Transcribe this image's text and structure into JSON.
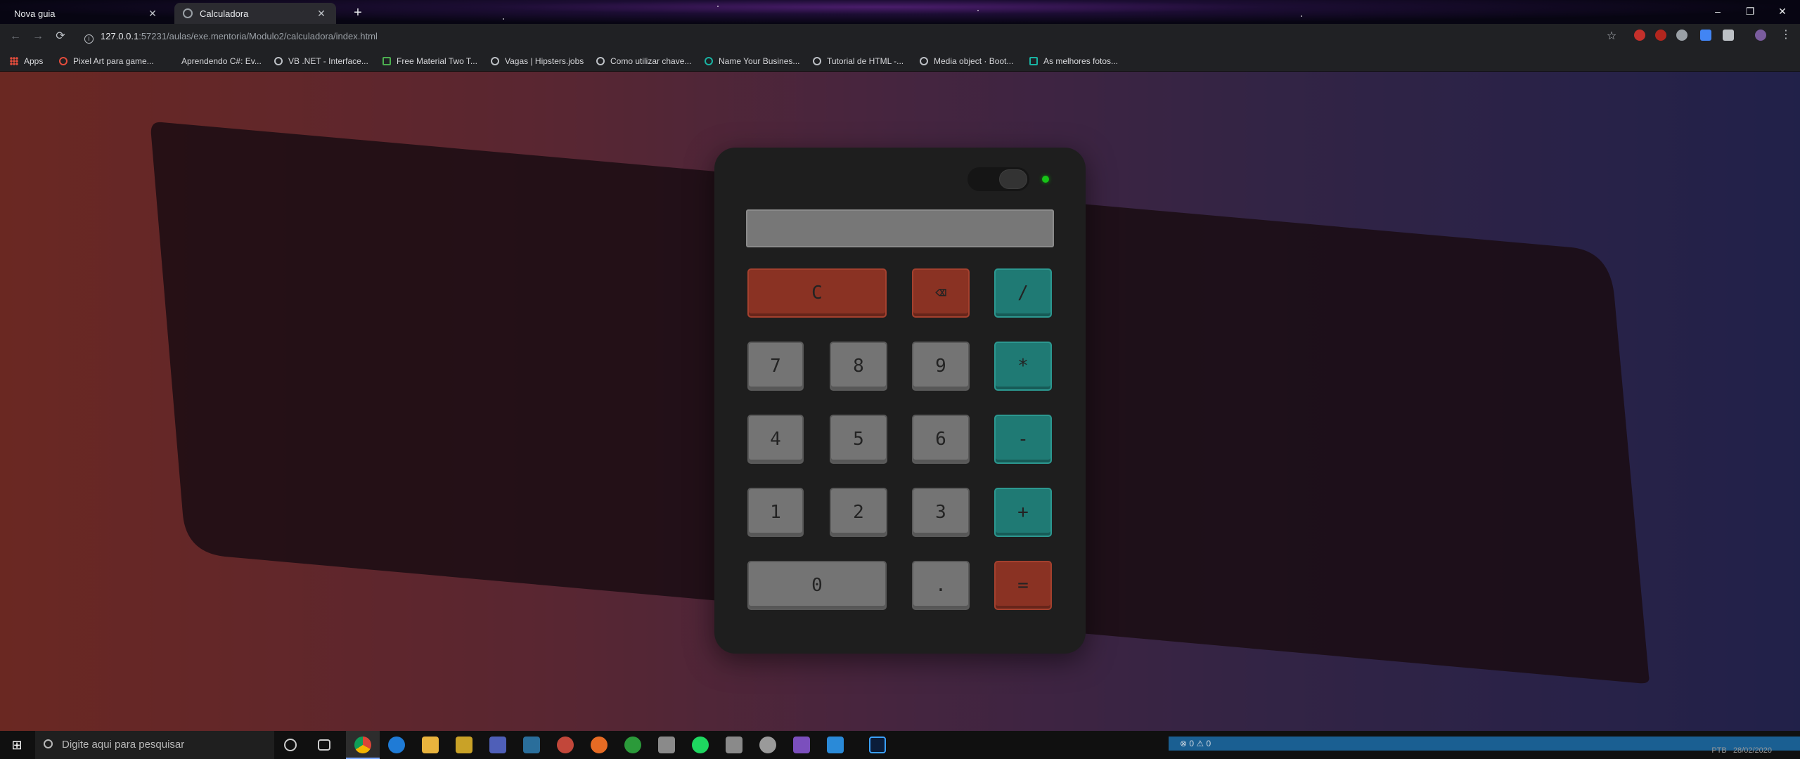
{
  "browser": {
    "tabs": [
      {
        "title": "Nova guia",
        "active": false
      },
      {
        "title": "Calculadora",
        "active": true
      }
    ],
    "new_tab_icon": "+",
    "window_controls": {
      "minimize": "–",
      "restore": "❐",
      "close": "✕"
    },
    "nav": {
      "back": "←",
      "forward": "→",
      "reload": "⟳"
    },
    "address": {
      "host": "127.0.0.1",
      "rest": ":57231/aulas/exe.mentoria/Modulo2/calculadora/index.html"
    },
    "bookmark_star": "☆",
    "bookmarks": [
      "Apps",
      "Pixel Art para game...",
      "Aprendendo C#: Ev...",
      "VB .NET - Interface...",
      "Free Material Two T...",
      "Vagas | Hipsters.jobs",
      "Como utilizar chave...",
      "Name Your Busines...",
      "Tutorial de HTML -...",
      "Media object · Boot...",
      "As melhores fotos..."
    ]
  },
  "calculator": {
    "display_value": "",
    "led_color": "#17c417",
    "keys": {
      "clear": "C",
      "backspace_icon": "⌫",
      "divide": "/",
      "seven": "7",
      "eight": "8",
      "nine": "9",
      "multiply": "*",
      "four": "4",
      "five": "5",
      "six": "6",
      "minus": "-",
      "one": "1",
      "two": "2",
      "three": "3",
      "plus": "+",
      "zero": "0",
      "dot": ".",
      "equals": "="
    }
  },
  "taskbar": {
    "search_placeholder": "Digite aqui para pesquisar",
    "status_text": "⊗ 0 ⚠ 0",
    "clock_line1": "PTB",
    "clock_line2": "28/02/2020"
  },
  "colors": {
    "page_gradient_left": "#c2493f",
    "page_gradient_right": "#3d3c86",
    "key_red": "#8a3223",
    "key_teal": "#1f7a74",
    "key_gray": "#747474"
  }
}
